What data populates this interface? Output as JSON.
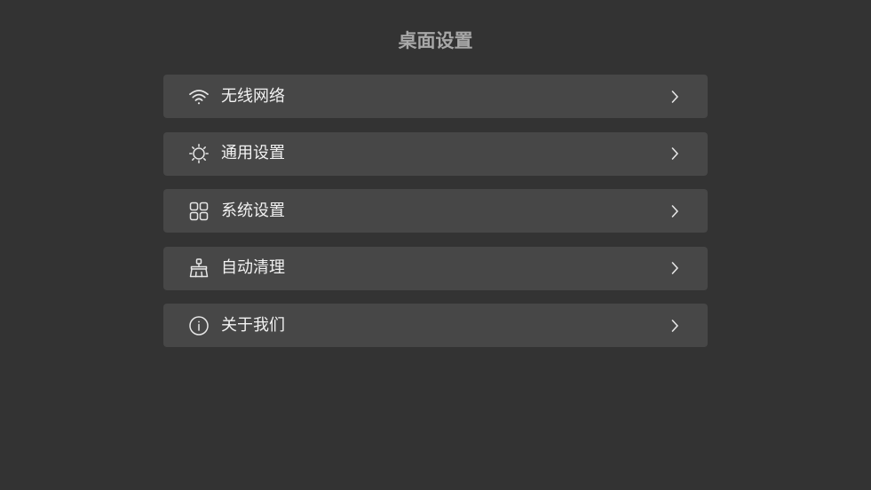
{
  "page": {
    "title": "桌面设置"
  },
  "menu": {
    "items": [
      {
        "label": "无线网络",
        "icon": "wifi-icon"
      },
      {
        "label": "通用设置",
        "icon": "sun-icon"
      },
      {
        "label": "系统设置",
        "icon": "grid-icon"
      },
      {
        "label": "自动清理",
        "icon": "broom-icon"
      },
      {
        "label": "关于我们",
        "icon": "info-icon"
      }
    ]
  },
  "colors": {
    "background": "#333333",
    "item_background": "#474747",
    "title": "#a8a8a8",
    "text": "#f2f2f2"
  }
}
